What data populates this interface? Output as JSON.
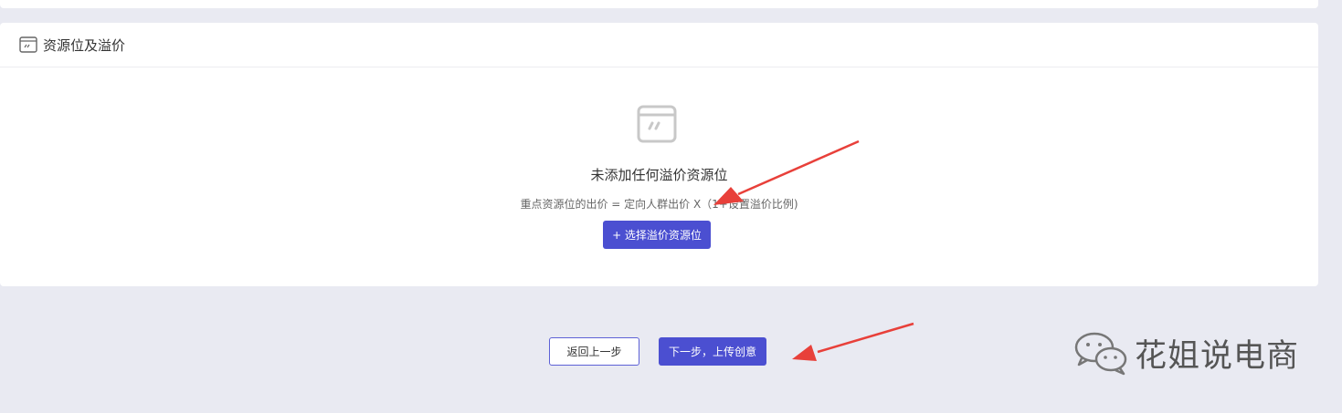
{
  "section": {
    "title": "资源位及溢价",
    "empty_title": "未添加任何溢价资源位",
    "empty_desc": "重点资源位的出价 = 定向人群出价 X（1+设置溢价比例)",
    "select_button": "+ 选择溢价资源位"
  },
  "footer": {
    "back_button": "返回上一步",
    "next_button": "下一步，上传创意"
  },
  "watermark": {
    "text": "花姐说电商",
    "icon": "wechat-icon"
  },
  "colors": {
    "primary": "#4b4fd1",
    "page_bg": "#e9eaf2",
    "annotation_arrow": "#e8403a"
  }
}
